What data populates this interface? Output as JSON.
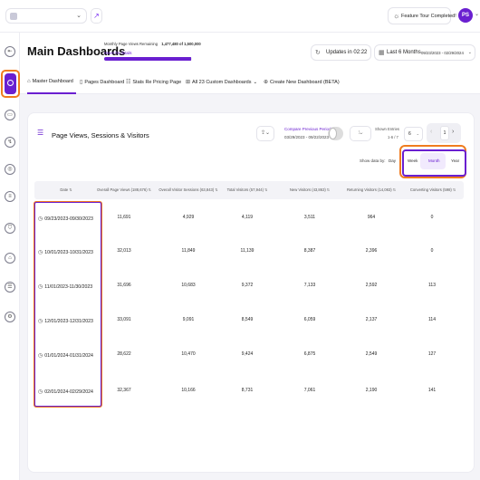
{
  "topbar": {
    "avatar_initials": "PS",
    "feature_tour_label": "Feature Tour Completed!"
  },
  "header": {
    "title": "Main Dashboards",
    "pageviews_remaining_label": "Monthly Page Views Remaining",
    "pageviews_remaining_value": "1,477,480 of 1,500,000",
    "pageviews_remaining_fraction": 0.985,
    "hover_for_details": "Hover for details",
    "updates_label": "Updates in 02:22",
    "date_range_label": "Last 6 Months",
    "date_range_value": "09/23/2023 - 02/29/2024"
  },
  "tabs": [
    {
      "label": "Master Dashboard",
      "icon": "dashboard-icon",
      "active": true
    },
    {
      "label": "Pages Dashboard",
      "icon": "pages-icon",
      "active": false
    },
    {
      "label": "Stats Re Pricing Page",
      "icon": "stats-icon",
      "active": false
    },
    {
      "label": "All 23 Custom Dashboards",
      "icon": "grid-icon",
      "active": false
    },
    {
      "label": "Create New Dashboard (BETA)",
      "icon": "plus-circle-icon",
      "active": false
    }
  ],
  "card": {
    "title": "Page Views, Sessions & Visitors",
    "compare_label": "Compare Previous Period",
    "compare_range": "03/29/2023 - 09/22/2023",
    "shown_entries_label": "Shown Entries",
    "shown_entries_sub": "1-6 / 7",
    "entries_value": "6",
    "page_number": "1",
    "show_by_label": "Show data by:",
    "show_by_options": [
      "Day",
      "Week",
      "Month",
      "Year"
    ],
    "show_by_selected": "Month"
  },
  "table": {
    "columns": [
      "Date",
      "Overall Page Views (188,676)",
      "Overall Visitor Sessions (63,843)",
      "Total Visitors (57,944)",
      "New Visitors (43,863)",
      "Returning Visitors (14,083)",
      "Converting Visitors (598)"
    ],
    "rows": [
      {
        "date": "09/23/2023-09/30/2023",
        "page_views": "11,691",
        "sessions": "4,929",
        "total_visitors": "4,119",
        "new_visitors": "3,511",
        "returning": "964",
        "converting": "0"
      },
      {
        "date": "10/01/2023-10/31/2023",
        "page_views": "32,013",
        "sessions": "11,849",
        "total_visitors": "11,139",
        "new_visitors": "8,387",
        "returning": "2,396",
        "converting": "0"
      },
      {
        "date": "11/01/2023-11/30/2023",
        "page_views": "31,696",
        "sessions": "10,683",
        "total_visitors": "9,372",
        "new_visitors": "7,133",
        "returning": "2,592",
        "converting": "113"
      },
      {
        "date": "12/01/2023-12/31/2023",
        "page_views": "33,091",
        "sessions": "9,091",
        "total_visitors": "8,549",
        "new_visitors": "6,059",
        "returning": "2,137",
        "converting": "114"
      },
      {
        "date": "01/01/2024-01/31/2024",
        "page_views": "28,622",
        "sessions": "10,470",
        "total_visitors": "9,424",
        "new_visitors": "6,875",
        "returning": "2,549",
        "converting": "127"
      },
      {
        "date": "02/01/2024-02/29/2024",
        "page_views": "32,367",
        "sessions": "10,166",
        "total_visitors": "8,731",
        "new_visitors": "7,061",
        "returning": "2,190",
        "converting": "141"
      }
    ]
  },
  "colors": {
    "accent": "#6a1fd0",
    "highlight": "#f07c1f"
  }
}
